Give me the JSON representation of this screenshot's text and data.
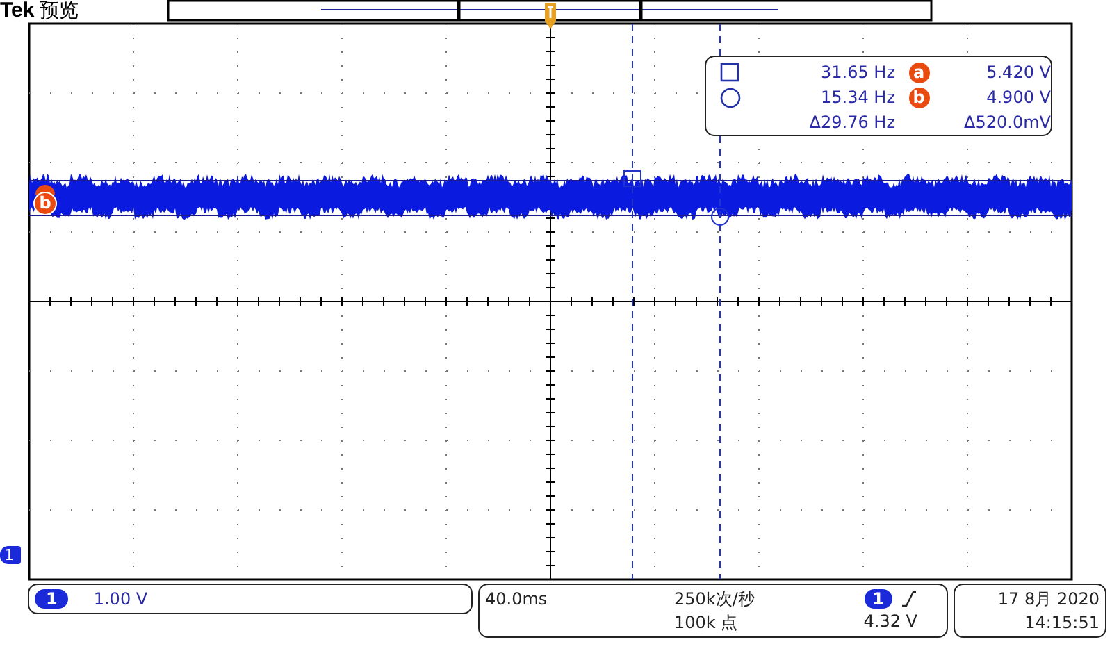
{
  "header": {
    "brand": "Tek",
    "mode": "预览"
  },
  "trace_markers": [
    "b"
  ],
  "channel_marker": "1",
  "cursor_readout": [
    {
      "kind": "square",
      "frequency": "31.65 Hz",
      "marker": "a",
      "voltage": "5.420 V"
    },
    {
      "kind": "circle",
      "frequency": "15.34 Hz",
      "marker": "b",
      "voltage": "4.900 V"
    },
    {
      "kind": "delta",
      "frequency": "Δ29.76 Hz",
      "voltage": "Δ520.0mV"
    }
  ],
  "channel": {
    "number": "1",
    "scale": "1.00 V"
  },
  "timebase": {
    "time_per_div": "40.0ms",
    "sample_rate": "250k次/秒",
    "record_length": "100k 点",
    "trigger_source": "1",
    "trigger_level": "4.32 V"
  },
  "datetime": {
    "date": "17 8月 2020",
    "time": "14:15:51"
  }
}
